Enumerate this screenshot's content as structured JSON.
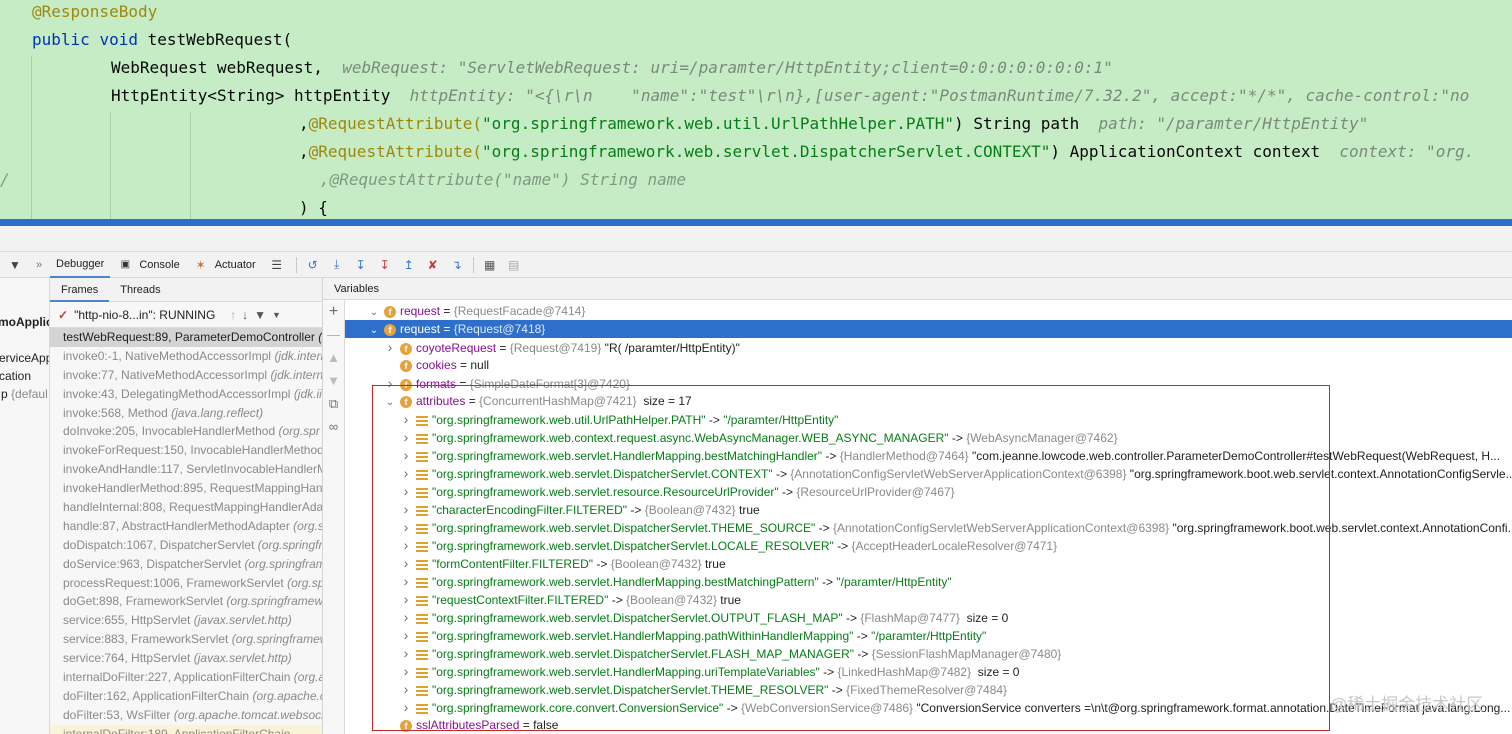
{
  "editor": {
    "line1": "@ResponseBody",
    "line2_kw1": "public",
    "line2_kw2": "void",
    "line2_rest": " testWebRequest(",
    "line3_code": "WebRequest webRequest,",
    "line3_hint": "webRequest: \"ServletWebRequest: uri=/paramter/HttpEntity;client=0:0:0:0:0:0:0:1\"",
    "line4_code": "HttpEntity<String> httpEntity",
    "line4_hint": "httpEntity: \"<{\\r\\n    \"name\":\"test\"\\r\\n},[user-agent:\"PostmanRuntime/7.32.2\", accept:\"*/*\", cache-control:\"no",
    "line5_comma": ",",
    "line5_ann": "@RequestAttribute(",
    "line5_str": "\"org.springframework.web.util.UrlPathHelper.PATH\"",
    "line5_rest": ") String path",
    "line5_hint": "path: \"/paramter/HttpEntity\"",
    "line6_comma": ",",
    "line6_ann": "@RequestAttribute(",
    "line6_str": "\"org.springframework.web.servlet.DispatcherServlet.CONTEXT\"",
    "line6_rest": ") ApplicationContext context",
    "line6_hint": "context: \"org.",
    "line7_left": "/",
    "line7_comment": ",@RequestAttribute(\"name\") String name",
    "line8": ") {"
  },
  "toolbar": {
    "debugger_label": "Debugger",
    "console_label": "Console",
    "actuator_label": "Actuator"
  },
  "strip": {
    "t1": "moApplic",
    "t2": "erviceApp",
    "t3": "cation",
    "t4": "p",
    "t4b": "{defaul"
  },
  "frames_panel": {
    "tab_frames": "Frames",
    "tab_threads": "Threads",
    "thread": "\"http-nio-8...in\": RUNNING",
    "frames": [
      {
        "text": "testWebRequest:89, ParameterDemoController",
        "pkg": "(c"
      },
      {
        "text": "invoke0:-1, NativeMethodAccessorImpl",
        "pkg": "(jdk.interi"
      },
      {
        "text": "invoke:77, NativeMethodAccessorImpl",
        "pkg": "(jdk.intern"
      },
      {
        "text": "invoke:43, DelegatingMethodAccessorImpl",
        "pkg": "(jdk.ii"
      },
      {
        "text": "invoke:568, Method",
        "pkg": "(java.lang.reflect)"
      },
      {
        "text": "doInvoke:205, InvocableHandlerMethod",
        "pkg": "(org.spr"
      },
      {
        "text": "invokeForRequest:150, InvocableHandlerMethod",
        "pkg": ""
      },
      {
        "text": "invokeAndHandle:117, ServletInvocableHandlerM",
        "pkg": ""
      },
      {
        "text": "invokeHandlerMethod:895, RequestMappingHanc",
        "pkg": ""
      },
      {
        "text": "handleInternal:808, RequestMappingHandlerAdap",
        "pkg": ""
      },
      {
        "text": "handle:87, AbstractHandlerMethodAdapter",
        "pkg": "(org.s"
      },
      {
        "text": "doDispatch:1067, DispatcherServlet",
        "pkg": "(org.springfr"
      },
      {
        "text": "doService:963, DispatcherServlet",
        "pkg": "(org.springfram"
      },
      {
        "text": "processRequest:1006, FrameworkServlet",
        "pkg": "(org.spr"
      },
      {
        "text": "doGet:898, FrameworkServlet",
        "pkg": "(org.springframew"
      },
      {
        "text": "service:655, HttpServlet",
        "pkg": "(javax.servlet.http)"
      },
      {
        "text": "service:883, FrameworkServlet",
        "pkg": "(org.springframew"
      },
      {
        "text": "service:764, HttpServlet",
        "pkg": "(javax.servlet.http)"
      },
      {
        "text": "internalDoFilter:227, ApplicationFilterChain",
        "pkg": "(org.a"
      },
      {
        "text": "doFilter:162, ApplicationFilterChain",
        "pkg": "(org.apache.ca"
      },
      {
        "text": "doFilter:53, WsFilter",
        "pkg": "(org.apache.tomcat.websock"
      },
      {
        "text": "internalDoFilter:189, ApplicationFilterChain",
        "pkg": ""
      }
    ]
  },
  "variables": {
    "header": "Variables",
    "rows": [
      {
        "indent": 0,
        "chev": "down",
        "badge": "f",
        "name": "request",
        "eq": " = ",
        "ref": "{RequestFacade@7414}",
        "val": "",
        "valclass": ""
      },
      {
        "indent": 1,
        "chev": "down",
        "badge": "f",
        "name": "request",
        "eq": " = ",
        "ref": "{Request@7418}",
        "val": "",
        "valclass": "",
        "sel": true
      },
      {
        "indent": 2,
        "chev": "right",
        "badge": "f",
        "name": "coyoteRequest",
        "eq": " = ",
        "ref": "{Request@7419}",
        "val": " \"R( /paramter/HttpEntity)\"",
        "valclass": ""
      },
      {
        "indent": 2,
        "chev": "",
        "badge": "f",
        "name": "cookies",
        "eq": " = ",
        "ref": "",
        "val": "null",
        "valclass": ""
      },
      {
        "indent": 2,
        "chev": "right",
        "badge": "f",
        "name": "formats",
        "eq": " = ",
        "ref": "{SimpleDateFormat[3]@7420}",
        "val": "",
        "valclass": ""
      },
      {
        "indent": 2,
        "chev": "down",
        "badge": "f",
        "name": "attributes",
        "eq": " = ",
        "ref": "{ConcurrentHashMap@7421}",
        "val": "  size = 17",
        "valclass": ""
      },
      {
        "indent": 3,
        "chev": "right",
        "badge": "l",
        "name": "",
        "key": "\"org.springframework.web.util.UrlPathHelper.PATH\"",
        "eq": " -> ",
        "ref": "",
        "val": "\"/paramter/HttpEntity\"",
        "valclass": "sv"
      },
      {
        "indent": 3,
        "chev": "right",
        "badge": "l",
        "name": "",
        "key": "\"org.springframework.web.context.request.async.WebAsyncManager.WEB_ASYNC_MANAGER\"",
        "eq": " -> ",
        "ref": "{WebAsyncManager@7462}",
        "val": "",
        "valclass": ""
      },
      {
        "indent": 3,
        "chev": "right",
        "badge": "l",
        "name": "",
        "key": "\"org.springframework.web.servlet.HandlerMapping.bestMatchingHandler\"",
        "eq": " -> ",
        "ref": "{HandlerMethod@7464}",
        "val": " \"com.jeanne.lowcode.web.controller.ParameterDemoController#testWebRequest(WebRequest, H...",
        "valclass": ""
      },
      {
        "indent": 3,
        "chev": "right",
        "badge": "l",
        "name": "",
        "key": "\"org.springframework.web.servlet.DispatcherServlet.CONTEXT\"",
        "eq": " -> ",
        "ref": "{AnnotationConfigServletWebServerApplicationContext@6398}",
        "val": " \"org.springframework.boot.web.servlet.context.AnnotationConfigServle...",
        "valclass": ""
      },
      {
        "indent": 3,
        "chev": "right",
        "badge": "l",
        "name": "",
        "key": "\"org.springframework.web.servlet.resource.ResourceUrlProvider\"",
        "eq": " -> ",
        "ref": "{ResourceUrlProvider@7467}",
        "val": "",
        "valclass": ""
      },
      {
        "indent": 3,
        "chev": "right",
        "badge": "l",
        "name": "",
        "key": "\"characterEncodingFilter.FILTERED\"",
        "eq": " -> ",
        "ref": "{Boolean@7432}",
        "val": " true",
        "valclass": ""
      },
      {
        "indent": 3,
        "chev": "right",
        "badge": "l",
        "name": "",
        "key": "\"org.springframework.web.servlet.DispatcherServlet.THEME_SOURCE\"",
        "eq": " -> ",
        "ref": "{AnnotationConfigServletWebServerApplicationContext@6398}",
        "val": " \"org.springframework.boot.web.servlet.context.AnnotationConfi...",
        "valclass": ""
      },
      {
        "indent": 3,
        "chev": "right",
        "badge": "l",
        "name": "",
        "key": "\"org.springframework.web.servlet.DispatcherServlet.LOCALE_RESOLVER\"",
        "eq": " -> ",
        "ref": "{AcceptHeaderLocaleResolver@7471}",
        "val": "",
        "valclass": ""
      },
      {
        "indent": 3,
        "chev": "right",
        "badge": "l",
        "name": "",
        "key": "\"formContentFilter.FILTERED\"",
        "eq": " -> ",
        "ref": "{Boolean@7432}",
        "val": " true",
        "valclass": ""
      },
      {
        "indent": 3,
        "chev": "right",
        "badge": "l",
        "name": "",
        "key": "\"org.springframework.web.servlet.HandlerMapping.bestMatchingPattern\"",
        "eq": " -> ",
        "ref": "",
        "val": "\"/paramter/HttpEntity\"",
        "valclass": "sv"
      },
      {
        "indent": 3,
        "chev": "right",
        "badge": "l",
        "name": "",
        "key": "\"requestContextFilter.FILTERED\"",
        "eq": " -> ",
        "ref": "{Boolean@7432}",
        "val": " true",
        "valclass": ""
      },
      {
        "indent": 3,
        "chev": "right",
        "badge": "l",
        "name": "",
        "key": "\"org.springframework.web.servlet.DispatcherServlet.OUTPUT_FLASH_MAP\"",
        "eq": " -> ",
        "ref": "{FlashMap@7477}",
        "val": "  size = 0",
        "valclass": ""
      },
      {
        "indent": 3,
        "chev": "right",
        "badge": "l",
        "name": "",
        "key": "\"org.springframework.web.servlet.HandlerMapping.pathWithinHandlerMapping\"",
        "eq": " -> ",
        "ref": "",
        "val": "\"/paramter/HttpEntity\"",
        "valclass": "sv"
      },
      {
        "indent": 3,
        "chev": "right",
        "badge": "l",
        "name": "",
        "key": "\"org.springframework.web.servlet.DispatcherServlet.FLASH_MAP_MANAGER\"",
        "eq": " -> ",
        "ref": "{SessionFlashMapManager@7480}",
        "val": "",
        "valclass": ""
      },
      {
        "indent": 3,
        "chev": "right",
        "badge": "l",
        "name": "",
        "key": "\"org.springframework.web.servlet.HandlerMapping.uriTemplateVariables\"",
        "eq": " -> ",
        "ref": "{LinkedHashMap@7482}",
        "val": "  size = 0",
        "valclass": ""
      },
      {
        "indent": 3,
        "chev": "right",
        "badge": "l",
        "name": "",
        "key": "\"org.springframework.web.servlet.DispatcherServlet.THEME_RESOLVER\"",
        "eq": " -> ",
        "ref": "{FixedThemeResolver@7484}",
        "val": "",
        "valclass": ""
      },
      {
        "indent": 3,
        "chev": "right",
        "badge": "l",
        "name": "",
        "key": "\"org.springframework.core.convert.ConversionService\"",
        "eq": " -> ",
        "ref": "{WebConversionService@7486}",
        "val": " \"ConversionService converters =\\n\\t@org.springframework.format.annotation.DateTimeFormat java.lang.Long...",
        "valclass": ""
      },
      {
        "indent": 2,
        "chev": "",
        "badge": "f",
        "name": "sslAttributesParsed",
        "eq": " = ",
        "ref": "",
        "val": "false",
        "valclass": ""
      }
    ]
  },
  "watermark": "@稀土掘金技术社区"
}
